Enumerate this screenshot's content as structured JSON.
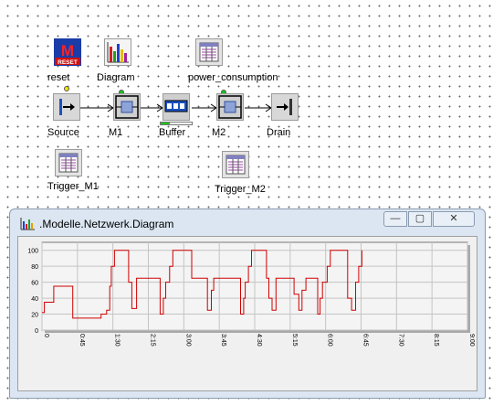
{
  "objects": {
    "reset": {
      "label": "reset",
      "badge": "RESET",
      "letter": "M"
    },
    "diagram": {
      "label": "Diagram"
    },
    "power_consumption": {
      "label": "power_consumption"
    },
    "source": {
      "label": "Source"
    },
    "m1": {
      "label": "M1"
    },
    "buffer": {
      "label": "Buffer"
    },
    "m2": {
      "label": "M2"
    },
    "drain": {
      "label": "Drain"
    },
    "trigger_m1": {
      "label": "Trigger_M1"
    },
    "trigger_m2": {
      "label": "Trigger_M2"
    }
  },
  "window": {
    "title": ".Modelle.Netzwerk.Diagram",
    "minimize": "—",
    "maximize": "▢",
    "close": "✕"
  },
  "chart_data": {
    "type": "line",
    "ylim": [
      0,
      110
    ],
    "yticks": [
      "0",
      "20",
      "40",
      "60",
      "80",
      "100"
    ],
    "xticks": [
      "0",
      "0:45",
      "1:30",
      "2:15",
      "3:00",
      "3:45",
      "4:30",
      "5:15",
      "6:00",
      "6:45",
      "7:30",
      "8:15",
      "9:00"
    ],
    "xlim": [
      0,
      540
    ],
    "series": [
      {
        "color": "#d00000",
        "points": [
          [
            0,
            22
          ],
          [
            3,
            22
          ],
          [
            3,
            35
          ],
          [
            15,
            35
          ],
          [
            15,
            55
          ],
          [
            39,
            55
          ],
          [
            39,
            15
          ],
          [
            75,
            15
          ],
          [
            75,
            20
          ],
          [
            82,
            20
          ],
          [
            82,
            25
          ],
          [
            86,
            25
          ],
          [
            86,
            55
          ],
          [
            88,
            55
          ],
          [
            88,
            80
          ],
          [
            92,
            80
          ],
          [
            92,
            100
          ],
          [
            110,
            100
          ],
          [
            110,
            60
          ],
          [
            114,
            60
          ],
          [
            114,
            27
          ],
          [
            120,
            27
          ],
          [
            120,
            65
          ],
          [
            150,
            65
          ],
          [
            150,
            20
          ],
          [
            154,
            20
          ],
          [
            154,
            40
          ],
          [
            157,
            40
          ],
          [
            157,
            60
          ],
          [
            162,
            60
          ],
          [
            162,
            80
          ],
          [
            166,
            80
          ],
          [
            166,
            100
          ],
          [
            190,
            100
          ],
          [
            190,
            65
          ],
          [
            210,
            65
          ],
          [
            210,
            25
          ],
          [
            215,
            25
          ],
          [
            215,
            50
          ],
          [
            218,
            50
          ],
          [
            218,
            65
          ],
          [
            252,
            65
          ],
          [
            252,
            20
          ],
          [
            256,
            20
          ],
          [
            256,
            40
          ],
          [
            258,
            40
          ],
          [
            258,
            60
          ],
          [
            262,
            60
          ],
          [
            262,
            80
          ],
          [
            266,
            80
          ],
          [
            266,
            100
          ],
          [
            285,
            100
          ],
          [
            285,
            65
          ],
          [
            288,
            65
          ],
          [
            288,
            40
          ],
          [
            292,
            40
          ],
          [
            292,
            25
          ],
          [
            297,
            25
          ],
          [
            297,
            65
          ],
          [
            320,
            65
          ],
          [
            320,
            45
          ],
          [
            326,
            45
          ],
          [
            326,
            25
          ],
          [
            330,
            25
          ],
          [
            330,
            50
          ],
          [
            335,
            50
          ],
          [
            335,
            65
          ],
          [
            350,
            65
          ],
          [
            350,
            20
          ],
          [
            353,
            20
          ],
          [
            353,
            40
          ],
          [
            356,
            40
          ],
          [
            356,
            60
          ],
          [
            362,
            60
          ],
          [
            362,
            80
          ],
          [
            366,
            80
          ],
          [
            366,
            100
          ],
          [
            388,
            100
          ],
          [
            388,
            40
          ],
          [
            393,
            40
          ],
          [
            393,
            25
          ],
          [
            398,
            25
          ],
          [
            398,
            60
          ],
          [
            402,
            60
          ],
          [
            402,
            80
          ],
          [
            406,
            80
          ],
          [
            406,
            100
          ]
        ]
      }
    ]
  }
}
